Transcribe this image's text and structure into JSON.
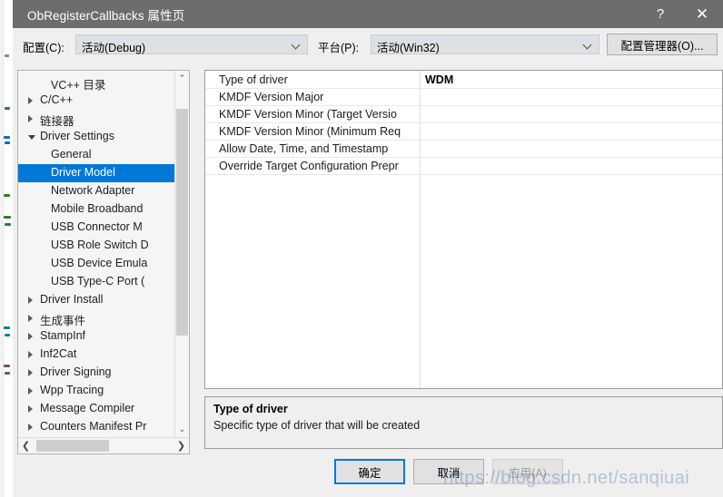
{
  "window": {
    "title": "ObRegisterCallbacks 属性页",
    "help_icon": "?",
    "close_icon": "✕"
  },
  "config_bar": {
    "config_label": "配置(C):",
    "config_value": "活动(Debug)",
    "platform_label": "平台(P):",
    "platform_value": "活动(Win32)",
    "config_manager_button": "配置管理器(O)..."
  },
  "tree": {
    "items": [
      {
        "label": "VC++ 目录",
        "indent": 2,
        "state": "leaf",
        "selected": false
      },
      {
        "label": "C/C++",
        "indent": 1,
        "state": "collapsed",
        "selected": false
      },
      {
        "label": "链接器",
        "indent": 1,
        "state": "collapsed",
        "selected": false
      },
      {
        "label": "Driver Settings",
        "indent": 1,
        "state": "expanded",
        "selected": false
      },
      {
        "label": "General",
        "indent": 2,
        "state": "leaf",
        "selected": false
      },
      {
        "label": "Driver Model",
        "indent": 2,
        "state": "leaf",
        "selected": true
      },
      {
        "label": "Network Adapter",
        "indent": 2,
        "state": "leaf",
        "selected": false
      },
      {
        "label": "Mobile Broadband",
        "indent": 2,
        "state": "leaf",
        "selected": false
      },
      {
        "label": "USB Connector M",
        "indent": 2,
        "state": "leaf",
        "selected": false
      },
      {
        "label": "USB Role Switch D",
        "indent": 2,
        "state": "leaf",
        "selected": false
      },
      {
        "label": "USB Device Emula",
        "indent": 2,
        "state": "leaf",
        "selected": false
      },
      {
        "label": "USB Type-C Port (",
        "indent": 2,
        "state": "leaf",
        "selected": false
      },
      {
        "label": "Driver Install",
        "indent": 1,
        "state": "collapsed",
        "selected": false
      },
      {
        "label": "生成事件",
        "indent": 1,
        "state": "collapsed",
        "selected": false
      },
      {
        "label": "StampInf",
        "indent": 1,
        "state": "collapsed",
        "selected": false
      },
      {
        "label": "Inf2Cat",
        "indent": 1,
        "state": "collapsed",
        "selected": false
      },
      {
        "label": "Driver Signing",
        "indent": 1,
        "state": "collapsed",
        "selected": false
      },
      {
        "label": "Wpp Tracing",
        "indent": 1,
        "state": "collapsed",
        "selected": false
      },
      {
        "label": "Message Compiler",
        "indent": 1,
        "state": "collapsed",
        "selected": false
      },
      {
        "label": "Counters Manifest Pr",
        "indent": 1,
        "state": "collapsed",
        "selected": false
      }
    ],
    "scroll_up_icon": "⌃",
    "scroll_down_icon": "⌄",
    "scroll_left_icon": "❮",
    "scroll_right_icon": "❯"
  },
  "property_grid": {
    "rows": [
      {
        "name": "Type of driver",
        "value": "WDM",
        "bold": true
      },
      {
        "name": "KMDF Version Major",
        "value": "",
        "bold": false
      },
      {
        "name": "KMDF Version Minor (Target Versio",
        "value": "",
        "bold": false
      },
      {
        "name": "KMDF Version Minor (Minimum Req",
        "value": "",
        "bold": false
      },
      {
        "name": "Allow Date, Time, and Timestamp",
        "value": "",
        "bold": false
      },
      {
        "name": "Override Target Configuration Prepr",
        "value": "",
        "bold": false
      }
    ]
  },
  "description": {
    "title": "Type of driver",
    "text": "Specific type of driver that will be created"
  },
  "footer": {
    "ok_label": "确定",
    "cancel_label": "取消",
    "apply_label": "应用(A)",
    "apply_enabled": false
  },
  "watermark": "https://blog.csdn.net/sanqiuai",
  "colors": {
    "titlebar": "#6d6d6d",
    "accent": "#0078d7",
    "dialog_bg": "#efefef",
    "grid_bg": "#ffffff"
  }
}
